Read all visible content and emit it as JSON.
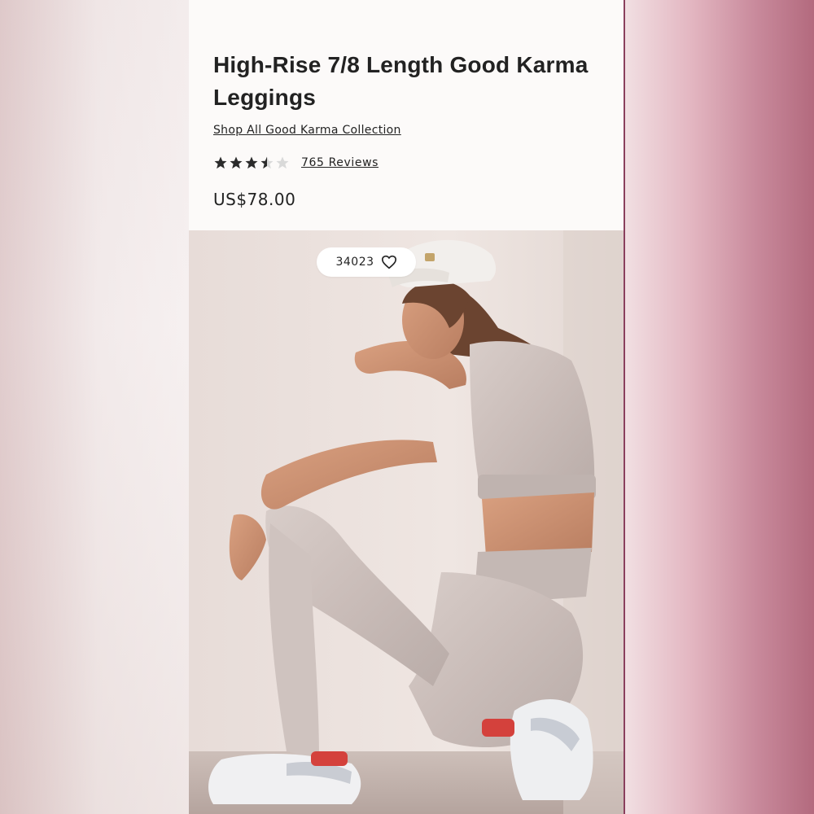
{
  "product": {
    "title": "High-Rise 7/8 Length Good Karma Leggings",
    "collection_link": "Shop All Good Karma Collection",
    "rating": 3.5,
    "rating_max": 5,
    "reviews_label": "765 Reviews",
    "price": "US$78.00"
  },
  "image": {
    "favorites_count": "34023",
    "favorite_icon": "heart-outline-icon"
  },
  "colors": {
    "frame_accent": "#8a3f5d",
    "star_filled": "#2b2b2b",
    "star_empty": "#d9d9d9"
  }
}
